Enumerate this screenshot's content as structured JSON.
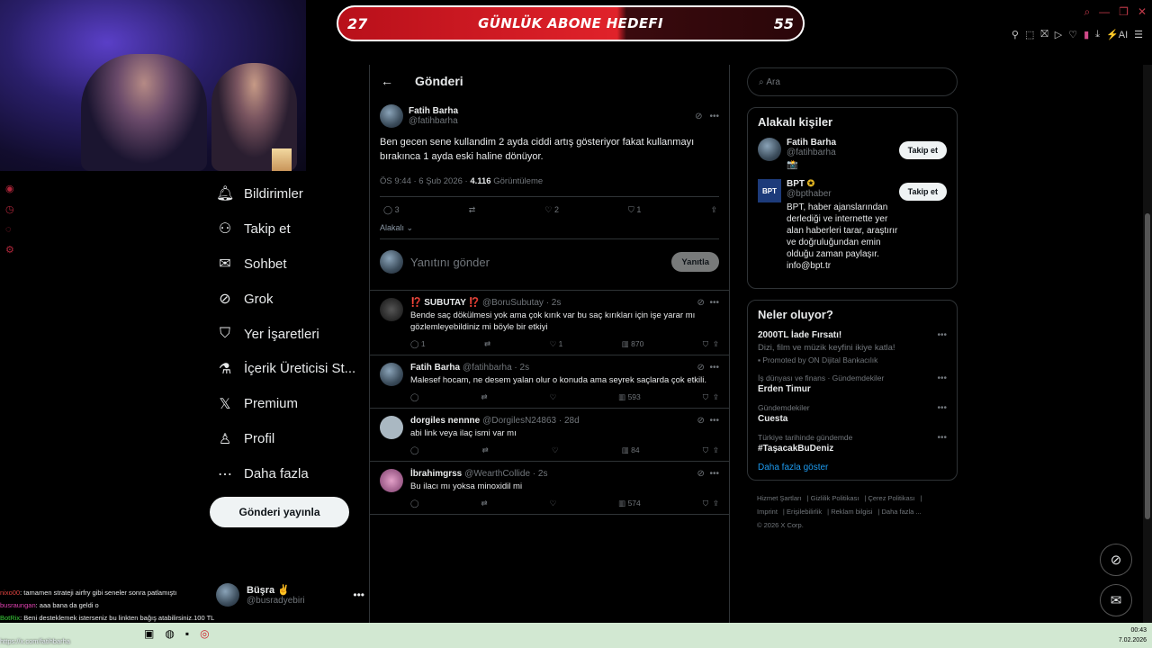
{
  "stream": {
    "goal_left": "27",
    "goal_title": "GÜNLÜK ABONE HEDEFI",
    "goal_right": "55"
  },
  "nav": {
    "items": [
      {
        "label": "Bildirimler",
        "icon": "bell-icon"
      },
      {
        "label": "Takip et",
        "icon": "add-user-icon"
      },
      {
        "label": "Sohbet",
        "icon": "mail-icon"
      },
      {
        "label": "Grok",
        "icon": "grok-icon"
      },
      {
        "label": "Yer İşaretleri",
        "icon": "bookmark-icon"
      },
      {
        "label": "İçerik Üreticisi St...",
        "icon": "flask-icon"
      },
      {
        "label": "Premium",
        "icon": "x-logo-icon"
      },
      {
        "label": "Profil",
        "icon": "person-icon"
      },
      {
        "label": "Daha fazla",
        "icon": "more-circle-icon"
      }
    ],
    "post_button": "Gönderi yayınla",
    "account": {
      "name": "Büşra ✌",
      "handle": "@busradyebiri"
    }
  },
  "main": {
    "title": "Gönderi",
    "tweet": {
      "name": "Fatih Barha",
      "handle": "@fatihbarha",
      "text": "Ben gecen sene kullandim 2 ayda ciddi artış gösteriyor fakat kullanmayı bırakınca 1 ayda eski haline dönüyor.",
      "time": "ÖS 9:44 · 6 Şub 2026 ·",
      "views": "4.116",
      "views_label": "Görüntüleme",
      "replies": "3",
      "likes": "2",
      "bookmarks": "1",
      "relevant": "Alakalı"
    },
    "reply_placeholder": "Yanıtını gönder",
    "reply_button": "Yanıtla",
    "replies": [
      {
        "name": "⁉️ SUBUTAY ⁉️",
        "handle": "@BoruSubutay · 2s",
        "text": "Bende saç dökülmesi yok ama çok kırık var bu saç kırıkları için işe yarar mı gözlemleyebildiniz mi böyle bir etkiyi",
        "replies": "1",
        "retweets": "",
        "likes": "1",
        "views": "870"
      },
      {
        "name": "Fatih Barha",
        "handle": "@fatihbarha · 2s",
        "text": "Malesef hocam, ne desem yalan olur o konuda ama seyrek saçlarda çok etkili.",
        "replies": "",
        "retweets": "",
        "likes": "",
        "views": "593"
      },
      {
        "name": "dorgiles nennne",
        "handle": "@DorgilesN24863 · 28d",
        "text": "abi link veya ilaç ismi var mı",
        "replies": "",
        "retweets": "",
        "likes": "",
        "views": "84"
      },
      {
        "name": "İbrahimgrss",
        "handle": "@WearthCollide · 2s",
        "text": "Bu ilacı mı yoksa minoxidil mi",
        "replies": "",
        "retweets": "",
        "likes": "",
        "views": "574"
      }
    ]
  },
  "right": {
    "search_placeholder": "Ara",
    "people_title": "Alakalı kişiler",
    "people": [
      {
        "name": "Fatih Barha",
        "handle": "@fatihbarha",
        "bio": "📸",
        "button": "Takip et"
      },
      {
        "name": "BPT",
        "handle": "@bpthaber",
        "bio": "BPT, haber ajanslarından derlediği ve internette yer alan haberleri tarar, araştırır ve doğruluğundan emin olduğu zaman paylaşır. info@bpt.tr",
        "button": "Takip et"
      }
    ],
    "trends_title": "Neler oluyor?",
    "ad": {
      "title": "2000TL İade Fırsatı!",
      "sub": "Dizi, film ve müzik keyfini ikiye katla!",
      "promo": "Promoted by ON Dijital Bankacılık"
    },
    "trends": [
      {
        "category": "İş dünyası ve finans · Gündemdekiler",
        "title": "Erden Timur"
      },
      {
        "category": "Gündemdekiler",
        "title": "Cuesta"
      },
      {
        "category": "Türkiye tarihinde gündemde",
        "title": "#TaşacakBuDeniz"
      }
    ],
    "show_more": "Daha fazla göster",
    "footer": [
      "Hizmet Şartları",
      "Gizlilik Politikası",
      "Çerez Politikası",
      "Imprint",
      "Erişilebilirlik",
      "Reklam bilgisi",
      "Daha fazla ...",
      "© 2026 X Corp."
    ]
  },
  "chat": [
    {
      "user": "nixo00",
      "msg": ": tamamen strateji airfry gibi seneler sonra patlamıştı"
    },
    {
      "user": "busraungan",
      "msg": ": aaa bana da geldi o"
    },
    {
      "user": "BotRix",
      "msg": ": Beni desteklemek isterseniz bu linkten bağış atabilirsiniz.100 TL"
    }
  ],
  "taskbar": {
    "url": "https://x.com/fatihbarha",
    "time": "00:43",
    "date": "7.02.2026"
  }
}
